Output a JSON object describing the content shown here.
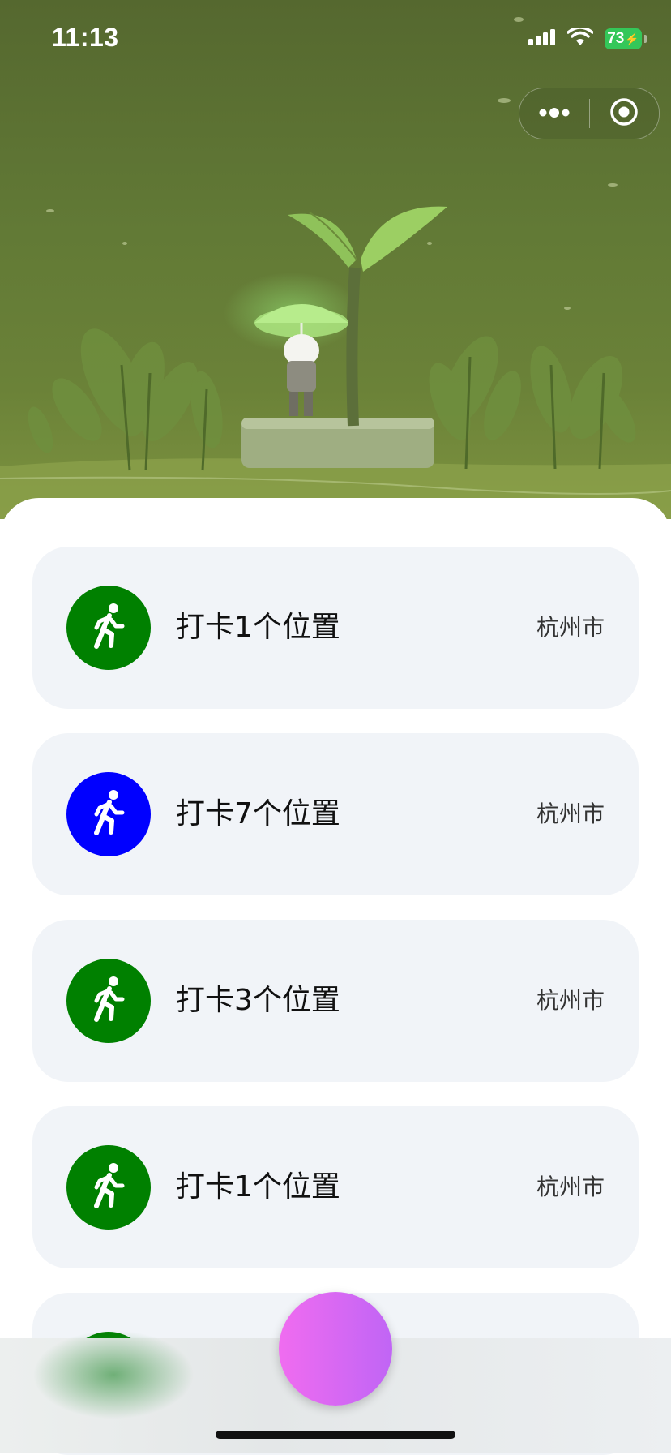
{
  "status_bar": {
    "time": "11:13",
    "battery": "73"
  },
  "capsule": {
    "more_icon": "more-dots-icon",
    "close_icon": "target-close-icon"
  },
  "list": [
    {
      "title": "打卡1个位置",
      "city": "杭州市",
      "color": "#008000",
      "icon": "runner-icon"
    },
    {
      "title": "打卡7个位置",
      "city": "杭州市",
      "color": "#0000ff",
      "icon": "runner-icon"
    },
    {
      "title": "打卡3个位置",
      "city": "杭州市",
      "color": "#008000",
      "icon": "runner-icon"
    },
    {
      "title": "打卡1个位置",
      "city": "杭州市",
      "color": "#008000",
      "icon": "runner-icon"
    }
  ],
  "colors": {
    "fab_gradient_start": "#f06cf0",
    "fab_gradient_end": "#c065f5",
    "card_bg": "#f1f4f8",
    "battery_green": "#34c759"
  }
}
